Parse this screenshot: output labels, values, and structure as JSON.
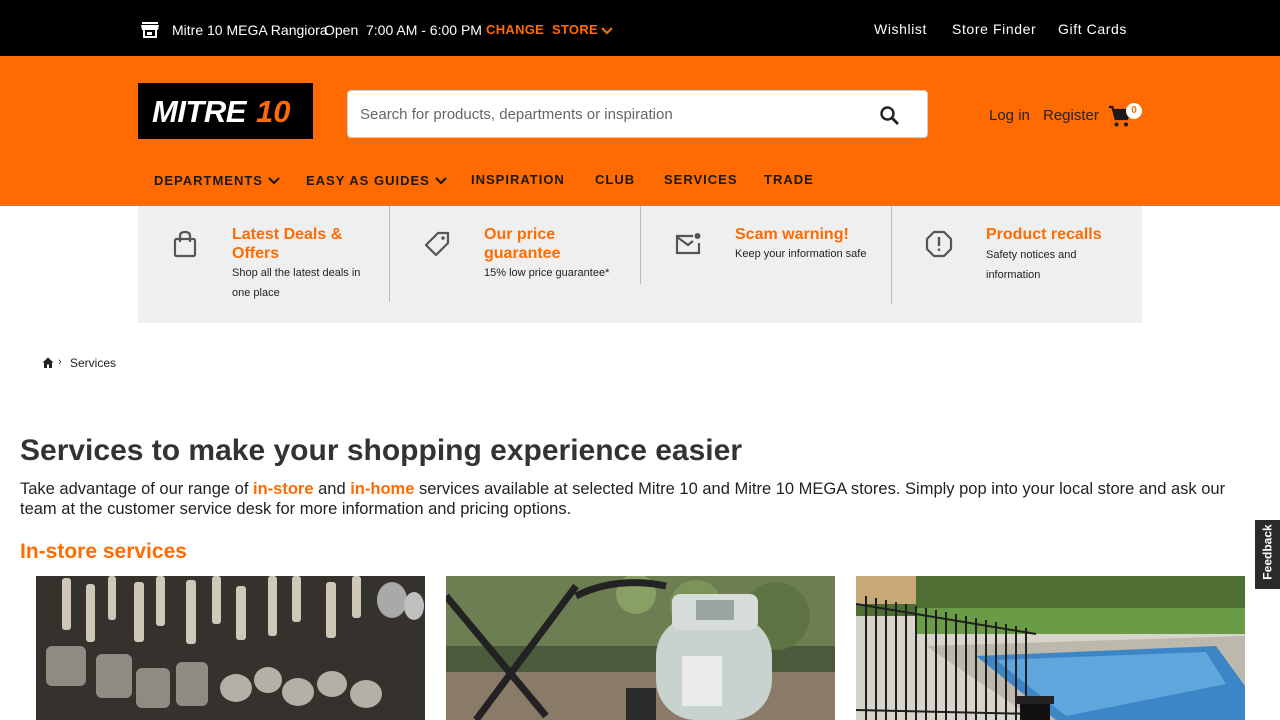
{
  "topbar": {
    "store_name": "Mitre 10 MEGA Rangiora",
    "store_status": "Open",
    "store_hours": "7:00 AM - 6:00 PM",
    "change_store": "CHANGE  STORE",
    "links": [
      "Wishlist",
      "Store Finder",
      "Gift Cards"
    ]
  },
  "header": {
    "logo_text": "MITRE 10",
    "search_placeholder": "Search for products, departments or inspiration",
    "login": "Log in",
    "register": "Register",
    "cart_count": "0",
    "nav": [
      "DEPARTMENTS",
      "EASY AS GUIDES",
      "INSPIRATION",
      "CLUB",
      "SERVICES",
      "TRADE"
    ]
  },
  "promos": [
    {
      "title": "Latest Deals & Offers",
      "desc": "Shop all the latest deals in one place",
      "icon": "shopping-bag-icon"
    },
    {
      "title": "Our price guarantee",
      "desc": "15% low price guarantee*",
      "icon": "price-tag-icon"
    },
    {
      "title": "Scam warning!",
      "desc": "Keep your information safe",
      "icon": "mail-alert-icon"
    },
    {
      "title": "Product recalls",
      "desc": "Safety notices and information",
      "icon": "alert-octagon-icon"
    }
  ],
  "breadcrumb": {
    "current": "Services",
    "separator": "›"
  },
  "main": {
    "title": "Services to make your shopping experience easier",
    "intro_before": "Take advantage of our range of ",
    "intro_link1": "in-store",
    "intro_mid": " and ",
    "intro_link2": "in-home",
    "intro_after": " services available at selected Mitre 10 and Mitre 10 MEGA stores. Simply pop into your local store and ask our team at the customer service desk for more information and pricing options.",
    "section_title": "In-store services"
  },
  "feedback": "Feedback",
  "colors": {
    "brand_orange": "#ff6b00",
    "top_bar": "#000000",
    "promo_bg": "#efefef"
  }
}
